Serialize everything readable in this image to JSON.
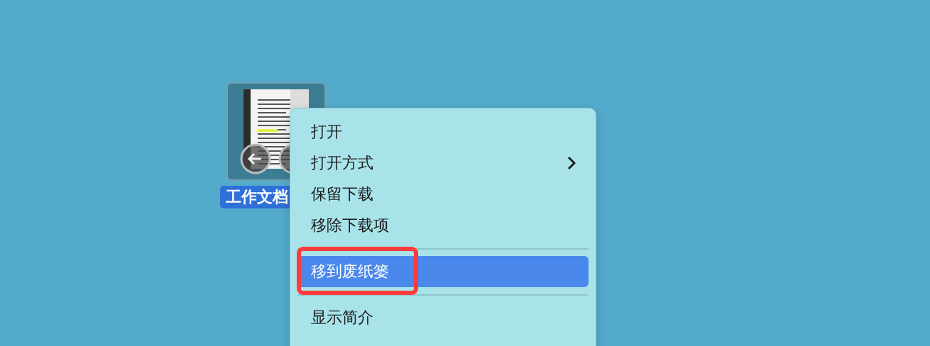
{
  "desktop_file": {
    "label": "工作文档",
    "selected": true
  },
  "context_menu": {
    "items": [
      {
        "kind": "item",
        "label": "打开",
        "submenu": false,
        "selected": false,
        "annotated": false
      },
      {
        "kind": "item",
        "label": "打开方式",
        "submenu": true,
        "selected": false,
        "annotated": false
      },
      {
        "kind": "item",
        "label": "保留下载",
        "submenu": false,
        "selected": false,
        "annotated": false
      },
      {
        "kind": "item",
        "label": "移除下载项",
        "submenu": false,
        "selected": false,
        "annotated": false
      },
      {
        "kind": "separator"
      },
      {
        "kind": "item",
        "label": "移到废纸篓",
        "submenu": false,
        "selected": true,
        "annotated": true
      },
      {
        "kind": "separator"
      },
      {
        "kind": "item",
        "label": "显示简介",
        "submenu": false,
        "selected": false,
        "annotated": false
      }
    ]
  }
}
